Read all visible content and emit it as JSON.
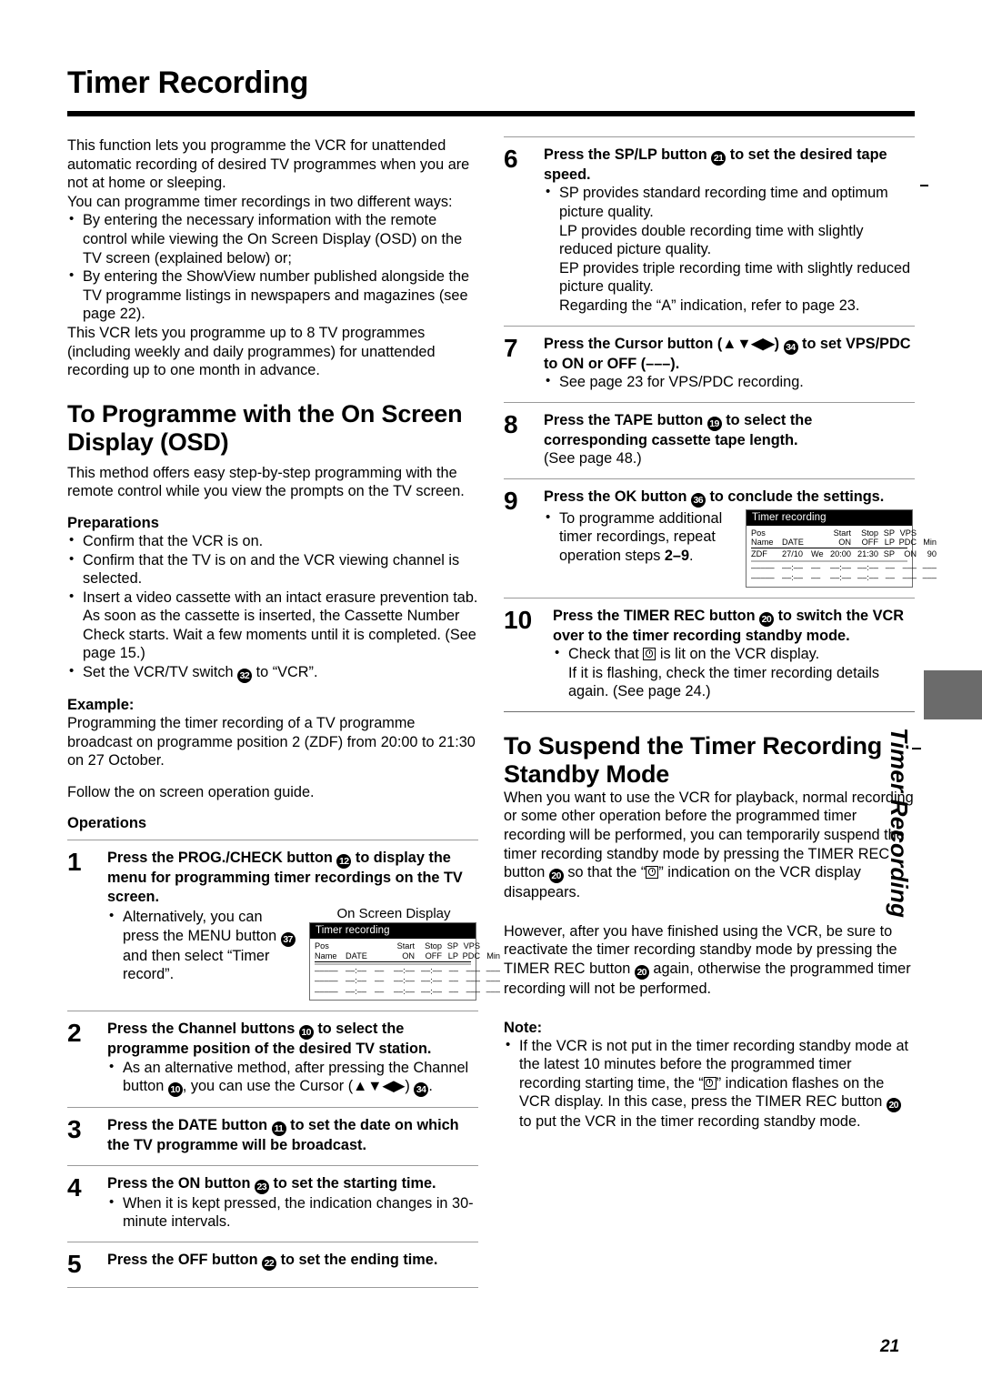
{
  "header": {
    "title": "Timer Recording"
  },
  "page_number": "21",
  "side_tab_label": "Timer Recording",
  "left_column": {
    "intro": {
      "p1": "This function lets you programme the VCR for unattended automatic recording of desired TV programmes when you are not at home or sleeping.",
      "p2": "You can programme timer recordings in two different ways:",
      "bullets": [
        "By entering the necessary information with the remote control while viewing the On Screen Display (OSD) on the TV screen (explained below) or;",
        "By entering the ShowView number published alongside the TV programme listings in newspapers and magazines (see page 22)."
      ],
      "p3": "This VCR lets you programme up to 8 TV programmes (including weekly and daily programmes) for unattended recording up to one month in advance."
    },
    "section_heading": "To Programme with the On Screen Display (OSD)",
    "section_intro": "This method offers easy step-by-step programming with the remote control while you view the prompts on the TV screen.",
    "preparations": {
      "heading": "Preparations",
      "bullets": [
        "Confirm that the VCR is on.",
        "Confirm that the TV is on and the VCR viewing channel is selected.",
        "Insert a video cassette with an intact erasure prevention tab.",
        "Set the VCR/TV switch "
      ],
      "b3_extra": "As soon as the cassette is inserted, the Cassette Number Check starts. Wait a few moments until it is completed. (See page 15.)",
      "b4_badge": "32",
      "b4_tail": " to “VCR”."
    },
    "example": {
      "heading": "Example:",
      "text": "Programming the timer recording of a TV programme broadcast on programme position 2 (ZDF) from 20:00 to 21:30 on 27 October.",
      "follow": "Follow the on screen operation guide."
    },
    "operations_heading": "Operations",
    "steps": [
      {
        "num": "1",
        "head_a": "Press the PROG./CHECK button ",
        "badge": "12",
        "head_b": " to display the menu for programming timer recordings on the TV screen.",
        "bullet_a": "Alternatively, you can press the MENU button ",
        "bullet_badge": "37",
        "bullet_b": " and then select “Timer record”."
      },
      {
        "num": "2",
        "head_a": "Press the Channel buttons ",
        "badge": "10",
        "head_b": " to select the programme position of the desired TV station.",
        "bullet_a": "As an alternative method, after pressing the Channel button ",
        "bullet_badge": "10",
        "bullet_b": ", you can use the Cursor (▲▼◀▶) ",
        "bullet_badge2": "34",
        "bullet_c": "."
      },
      {
        "num": "3",
        "head_a": "Press the DATE button ",
        "badge": "11",
        "head_b": " to set the date on which the TV programme will be broadcast."
      },
      {
        "num": "4",
        "head_a": "Press the ON button ",
        "badge": "23",
        "head_b": " to set the starting time.",
        "bullet_a": "When it is kept pressed, the indication changes in 30-minute intervals."
      },
      {
        "num": "5",
        "head_a": "Press the OFF button ",
        "badge": "22",
        "head_b": " to set the ending time."
      }
    ],
    "osd_caption": "On Screen Display"
  },
  "right_column": {
    "steps": [
      {
        "num": "6",
        "head_a": "Press the SP/LP button ",
        "badge": "21",
        "head_b": " to set the desired tape speed.",
        "bullet_lines": [
          "SP provides standard recording time and optimum picture quality.",
          "LP provides double recording time with slightly reduced picture quality.",
          "EP provides triple recording time with slightly reduced picture quality.",
          "Regarding the “A” indication, refer to page 23."
        ]
      },
      {
        "num": "7",
        "head_a": "Press the Cursor button (▲▼◀▶) ",
        "badge": "34",
        "head_b": " to set VPS/PDC to ON or OFF (–––).",
        "bullet_a": "See page 23 for VPS/PDC recording."
      },
      {
        "num": "8",
        "head_a": "Press the TAPE button ",
        "badge": "19",
        "head_b": " to select the corresponding cassette tape length.",
        "sub_plain": "(See page 48.)"
      },
      {
        "num": "9",
        "head_a": "Press the OK button ",
        "badge": "36",
        "head_b": " to conclude the settings.",
        "bullet_a": "To programme additional timer recordings, repeat operation steps ",
        "bullet_bold": "2–9",
        "bullet_b": "."
      },
      {
        "num": "10",
        "head_a": "Press the TIMER REC button ",
        "badge": "20",
        "head_b": " to switch the VCR over to the timer recording standby mode.",
        "bullet_a": "Check that ",
        "bullet_b": " is lit on the VCR display.",
        "bullet_c": "If it is flashing, check the timer recording details again. (See page 24.)"
      }
    ],
    "suspend": {
      "heading": "To Suspend the Timer Recording Standby Mode",
      "p1_a": "When you want to use the VCR for playback, normal recording or some other operation before the programmed timer recording will be performed, you can temporarily suspend the timer recording standby mode by pressing the TIMER REC button ",
      "p1_badge": "20",
      "p1_b": " so that the “",
      "p1_c": "” indication on the VCR display disappears.",
      "p2_a": "However, after you have finished using the VCR, be sure to reactivate the timer recording standby mode by pressing the TIMER REC button ",
      "p2_badge": "20",
      "p2_b": " again, otherwise the programmed timer recording will not be performed.",
      "note_heading": "Note:",
      "note_a": "If the VCR is not put in the timer recording standby mode at the latest 10 minutes before the programmed timer recording starting time, the “",
      "note_b": "” indication flashes on the VCR display. In this case, press the TIMER REC button ",
      "note_badge": "20",
      "note_c": " to put the VCR in the timer recording standby mode."
    }
  },
  "osd_screens": {
    "empty": {
      "title": "Timer recording",
      "header_row1": [
        "Pos",
        "",
        "",
        "Start",
        "Stop",
        "SP",
        "VPS",
        ""
      ],
      "header_row2": [
        "Name",
        "DATE",
        "",
        "ON",
        "OFF",
        "LP",
        "PDC",
        "Min"
      ],
      "rows": [
        [
          "–––––",
          "––:––",
          "––",
          "––:––",
          "––:––",
          "––",
          "–––",
          "–––"
        ],
        [
          "–––––",
          "––:––",
          "––",
          "––:––",
          "––:––",
          "––",
          "–––",
          "–––"
        ],
        [
          "–––––",
          "––:––",
          "––",
          "––:––",
          "––:––",
          "––",
          "–––",
          "–––"
        ]
      ]
    },
    "filled": {
      "title": "Timer recording",
      "header_row1": [
        "Pos",
        "",
        "",
        "Start",
        "Stop",
        "SP",
        "VPS",
        ""
      ],
      "header_row2": [
        "Name",
        "DATE",
        "",
        "ON",
        "OFF",
        "LP",
        "PDC",
        "Min"
      ],
      "rows": [
        [
          "ZDF",
          "27/10",
          "We",
          "20:00",
          "21:30",
          "SP",
          "ON",
          "90"
        ],
        [
          "–––––",
          "––:––",
          "––",
          "––:––",
          "––:––",
          "––",
          "–––",
          "–––"
        ],
        [
          "–––––",
          "––:––",
          "––",
          "––:––",
          "––:––",
          "––",
          "–––",
          "–––"
        ]
      ]
    }
  }
}
